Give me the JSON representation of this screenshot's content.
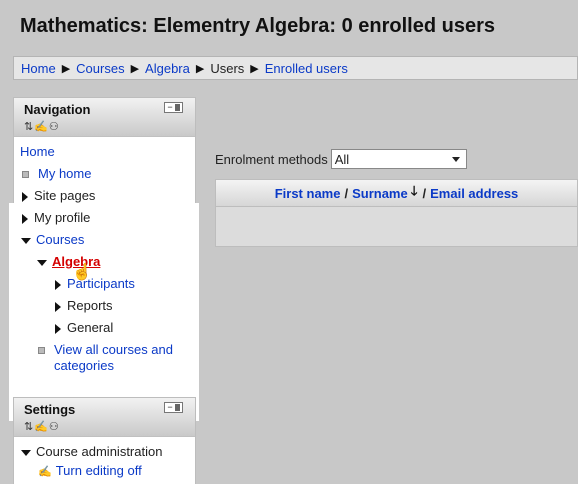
{
  "page": {
    "title": "Mathematics: Elementry Algebra: 0 enrolled users"
  },
  "breadcrumb": [
    "Home",
    "Courses",
    "Algebra",
    "Users",
    "Enrolled users"
  ],
  "navigation": {
    "title": "Navigation",
    "items": {
      "home": "Home",
      "my_home": "My home",
      "site_pages": "Site pages",
      "my_profile": "My profile",
      "courses": "Courses",
      "algebra": "Algebra",
      "participants": "Participants",
      "reports": "Reports",
      "general": "General",
      "view_all_1": "View all courses and",
      "view_all_2": "categories"
    }
  },
  "settings": {
    "title": "Settings",
    "items": {
      "course_admin": "Course administration",
      "turn_editing_off": "Turn editing off"
    }
  },
  "enrolment": {
    "label": "Enrolment methods",
    "selected": "All"
  },
  "table": {
    "first_name": "First name",
    "surname": "Surname",
    "email": "Email address",
    "separator": "/"
  },
  "icons": {
    "move": "move-icon",
    "edit": "edit-icon",
    "roles": "roles-icon",
    "sort_desc": "sort-down-arrow-icon"
  },
  "colors": {
    "link": "#0b3ac7",
    "active": "#d40000",
    "background": "#c8c8c8"
  }
}
